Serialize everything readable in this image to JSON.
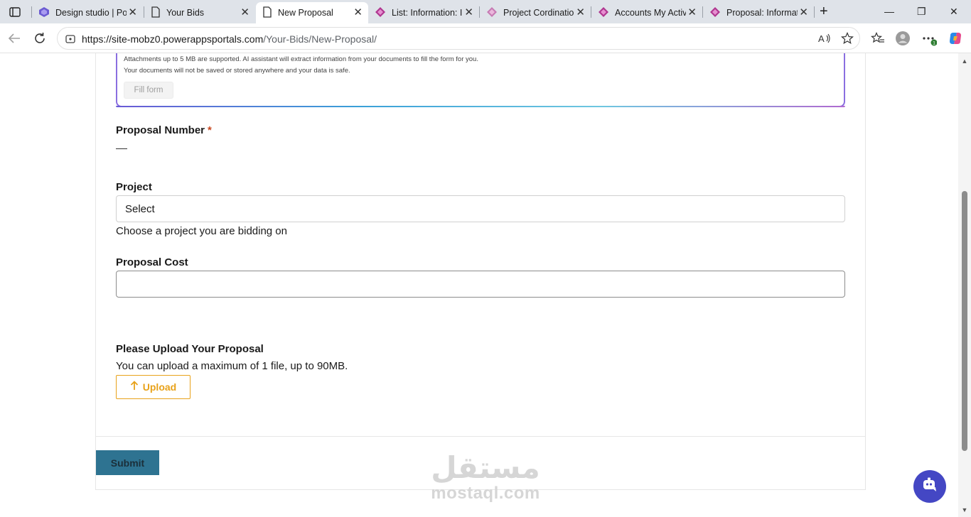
{
  "browser": {
    "tabs": [
      {
        "title": "Design studio | Po",
        "icon": "power-pages-icon",
        "active": false
      },
      {
        "title": "Your Bids",
        "icon": "page-icon",
        "active": false
      },
      {
        "title": "New Proposal",
        "icon": "page-icon",
        "active": true
      },
      {
        "title": "List: Information: I",
        "icon": "power-apps-icon",
        "active": false
      },
      {
        "title": "Project Cordinatio",
        "icon": "power-apps-icon",
        "active": false
      },
      {
        "title": "Accounts My Activ",
        "icon": "power-apps-icon",
        "active": false
      },
      {
        "title": "Proposal: Informat",
        "icon": "power-apps-icon",
        "active": false
      }
    ],
    "new_tab_symbol": "+",
    "url_host": "https://site-mobz0.powerappsportals.com",
    "url_path": "/Your-Bids/New-Proposal/",
    "window_controls": {
      "minimize": "—",
      "restore": "❐",
      "close": "✕"
    }
  },
  "form": {
    "ai_notice_line1": "Attachments up to 5 MB are supported. AI assistant will extract information from your documents to fill the form for you.",
    "ai_notice_line2": "Your documents will not be saved or stored anywhere and your data is safe.",
    "fill_form_label": "Fill form",
    "proposal_number_label": "Proposal Number",
    "required_marker": "*",
    "project_label": "Project",
    "project_value": "Select",
    "project_help": "Choose a project you are bidding on",
    "proposal_cost_label": "Proposal Cost",
    "proposal_cost_value": "",
    "upload_label": "Please Upload Your Proposal",
    "upload_help": "You can upload a maximum of 1 file, up to 90MB.",
    "upload_button": "Upload",
    "submit_button": "Submit"
  },
  "watermark": {
    "arabic": "مستقل",
    "latin": "mostaql.com"
  },
  "colors": {
    "accent_upload": "#e8a21a",
    "submit_bg": "#2e7391",
    "chat_fab": "#4447c4",
    "required": "#c8461e"
  }
}
